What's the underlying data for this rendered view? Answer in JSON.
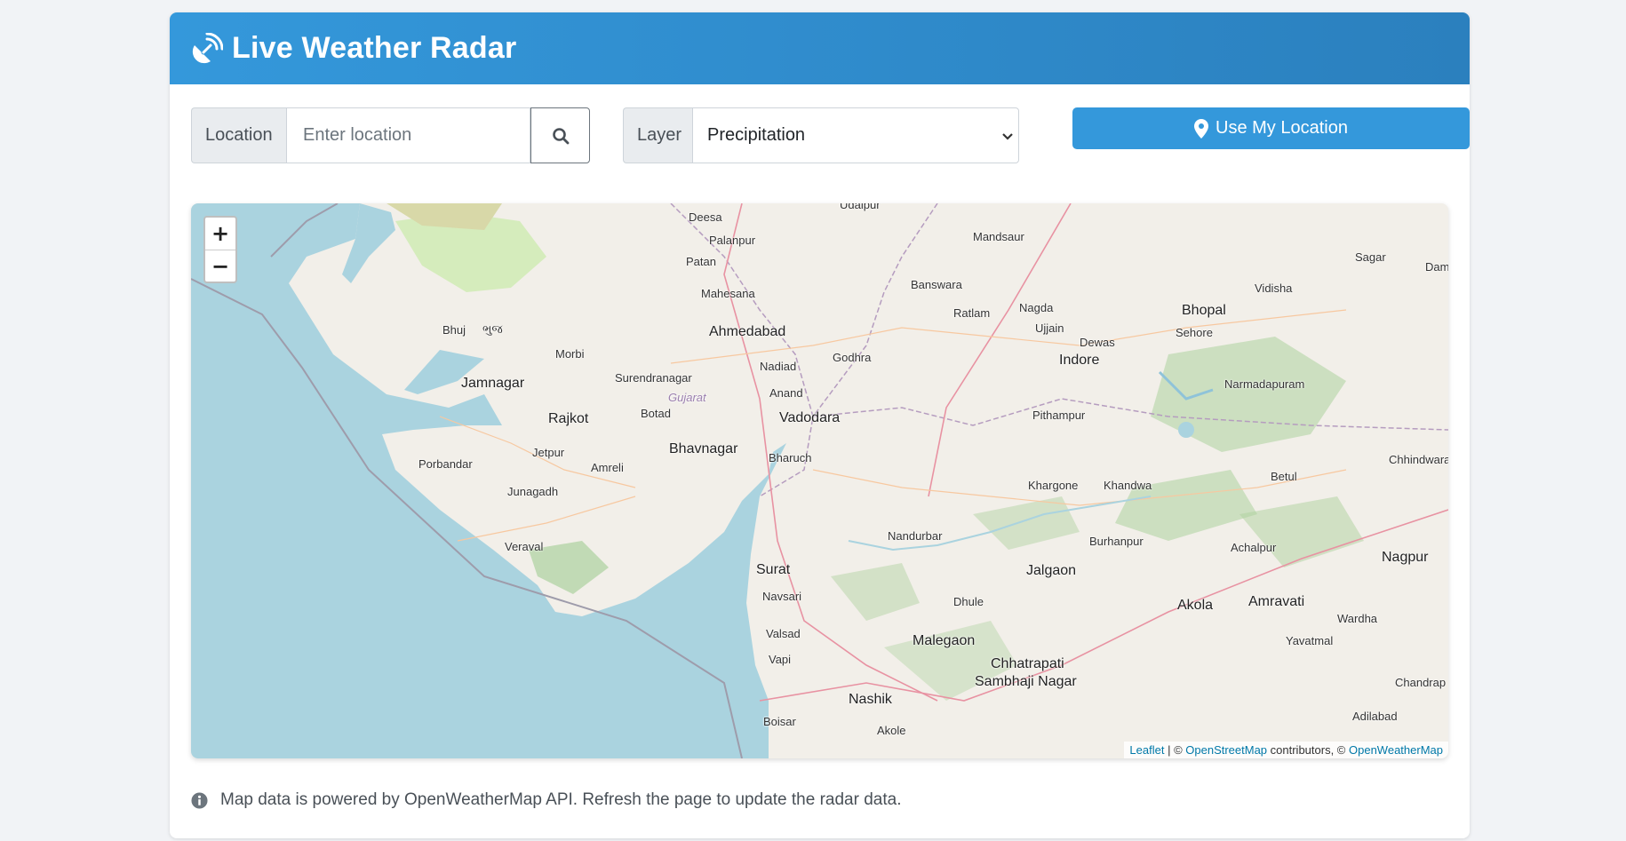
{
  "header": {
    "title": "Live Weather Radar",
    "icon": "satellite-dish-icon"
  },
  "controls": {
    "location_label": "Location",
    "location_placeholder": "Enter location",
    "location_value": "",
    "layer_label": "Layer",
    "layer_selected": "Precipitation",
    "use_location_label": "Use My Location"
  },
  "map": {
    "zoom_in": "+",
    "zoom_out": "−",
    "attribution": {
      "leaflet": "Leaflet",
      "sep1": " | © ",
      "osm": "OpenStreetMap",
      "sep2": " contributors, © ",
      "owm": "OpenWeatherMap"
    },
    "labels": [
      "Deesa",
      "Palanpur",
      "Patan",
      "Mahesana",
      "Udaipur",
      "Mandsaur",
      "Banswara",
      "Ratlam",
      "Nagda",
      "Ujjain",
      "Dewas",
      "Indore",
      "Bhopal",
      "Sehore",
      "Vidisha",
      "Sagar",
      "Ahmedabad",
      "Nadiad",
      "Godhra",
      "Anand",
      "Vadodara",
      "Bhuj",
      "ભુજ",
      "Morbi",
      "Surendranagar",
      "Gujarat",
      "Jamnagar",
      "Rajkot",
      "Botad",
      "Bhavnagar",
      "Jetpur",
      "Amreli",
      "Porbandar",
      "Junagadh",
      "Veraval",
      "Bharuch",
      "Surat",
      "Navsari",
      "Valsad",
      "Vapi",
      "Boisar",
      "Nashik",
      "Akole",
      "Nandurbar",
      "Dhule",
      "Malegaon",
      "Jalgaon",
      "Khargone",
      "Khandwa",
      "Burhanpur",
      "Pithampur",
      "Narmadapuram",
      "Betul",
      "Chhindwara",
      "Achalpur",
      "Amravati",
      "Akola",
      "Nagpur",
      "Wardha",
      "Yavatmal",
      "Chhatrapati",
      "Sambhaji Nagar",
      "Chandrap",
      "Adilabad",
      "Dam"
    ]
  },
  "info": {
    "icon": "info-circle-icon",
    "text": "Map data is powered by OpenWeatherMap API. Refresh the page to update the radar data."
  },
  "colors": {
    "header_start": "#3498db",
    "header_end": "#2b80be",
    "button": "#3498db",
    "sea": "#aad3df",
    "land": "#f2efe9"
  }
}
